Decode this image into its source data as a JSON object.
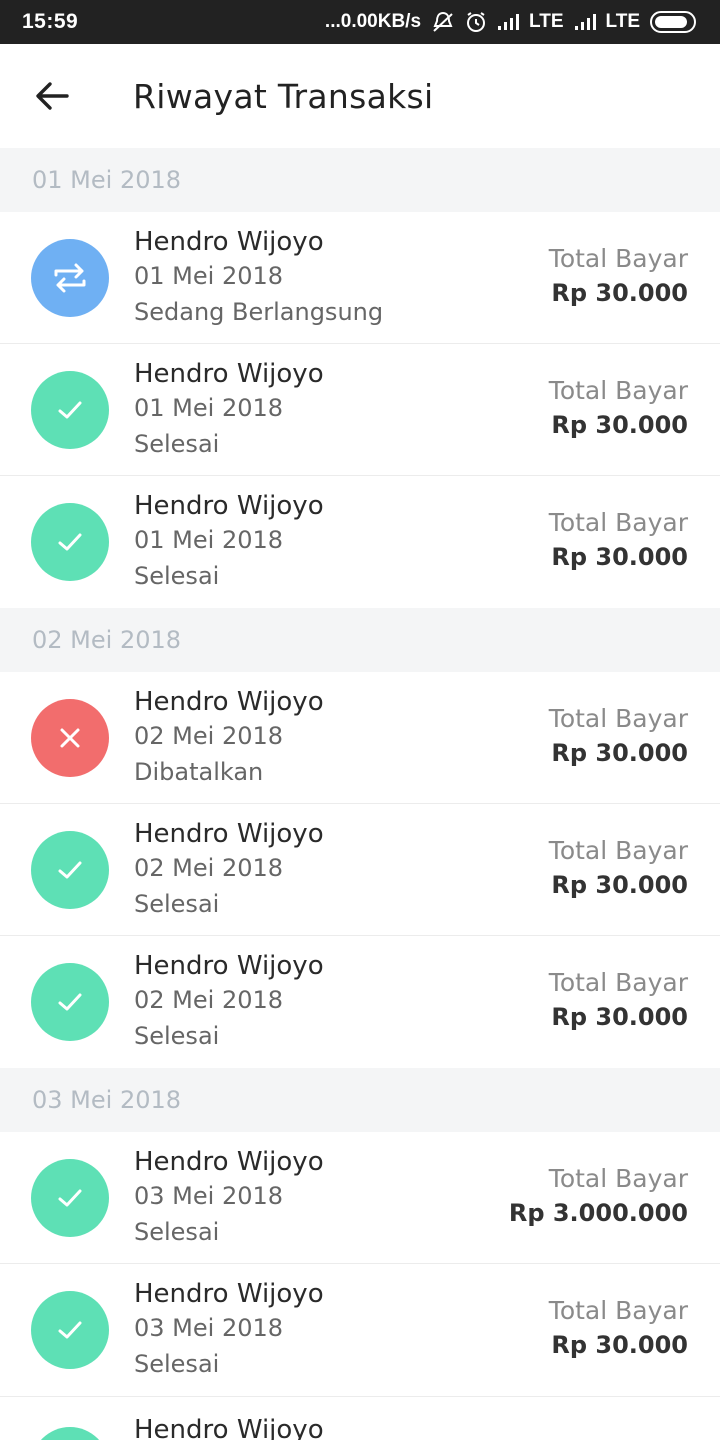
{
  "status_bar": {
    "time": "15:59",
    "network": "...0.00KB/s",
    "lte1": "LTE",
    "lte2": "LTE"
  },
  "header": {
    "title": "Riwayat Transaksi",
    "back_icon": "arrow-left-icon"
  },
  "colors": {
    "ongoing": "#6fb0f3",
    "done": "#5ee0b5",
    "cancelled": "#f26d6d",
    "section_bg": "#f4f5f6"
  },
  "amount_label": "Total Bayar",
  "sections": [
    {
      "date": "01 Mei 2018",
      "items": [
        {
          "name": "Hendro Wijoyo",
          "date": "01 Mei 2018",
          "status": "Sedang Berlangsung",
          "amount": "Rp 30.000",
          "icon": "exchange-icon"
        },
        {
          "name": "Hendro Wijoyo",
          "date": "01 Mei 2018",
          "status": "Selesai",
          "amount": "Rp 30.000",
          "icon": "check-icon"
        },
        {
          "name": "Hendro Wijoyo",
          "date": "01 Mei 2018",
          "status": "Selesai",
          "amount": "Rp 30.000",
          "icon": "check-icon"
        }
      ]
    },
    {
      "date": "02 Mei 2018",
      "items": [
        {
          "name": "Hendro Wijoyo",
          "date": "02 Mei 2018",
          "status": "Dibatalkan",
          "amount": "Rp 30.000",
          "icon": "close-icon"
        },
        {
          "name": "Hendro Wijoyo",
          "date": "02 Mei 2018",
          "status": "Selesai",
          "amount": "Rp 30.000",
          "icon": "check-icon"
        },
        {
          "name": "Hendro Wijoyo",
          "date": "02 Mei 2018",
          "status": "Selesai",
          "amount": "Rp 30.000",
          "icon": "check-icon"
        }
      ]
    },
    {
      "date": "03 Mei 2018",
      "items": [
        {
          "name": "Hendro Wijoyo",
          "date": "03 Mei 2018",
          "status": "Selesai",
          "amount": "Rp 3.000.000",
          "icon": "check-icon"
        },
        {
          "name": "Hendro Wijoyo",
          "date": "03 Mei 2018",
          "status": "Selesai",
          "amount": "Rp 30.000",
          "icon": "check-icon"
        }
      ]
    }
  ],
  "partial_item": {
    "name": "Hendro Wijoyo",
    "icon": "check-icon"
  }
}
